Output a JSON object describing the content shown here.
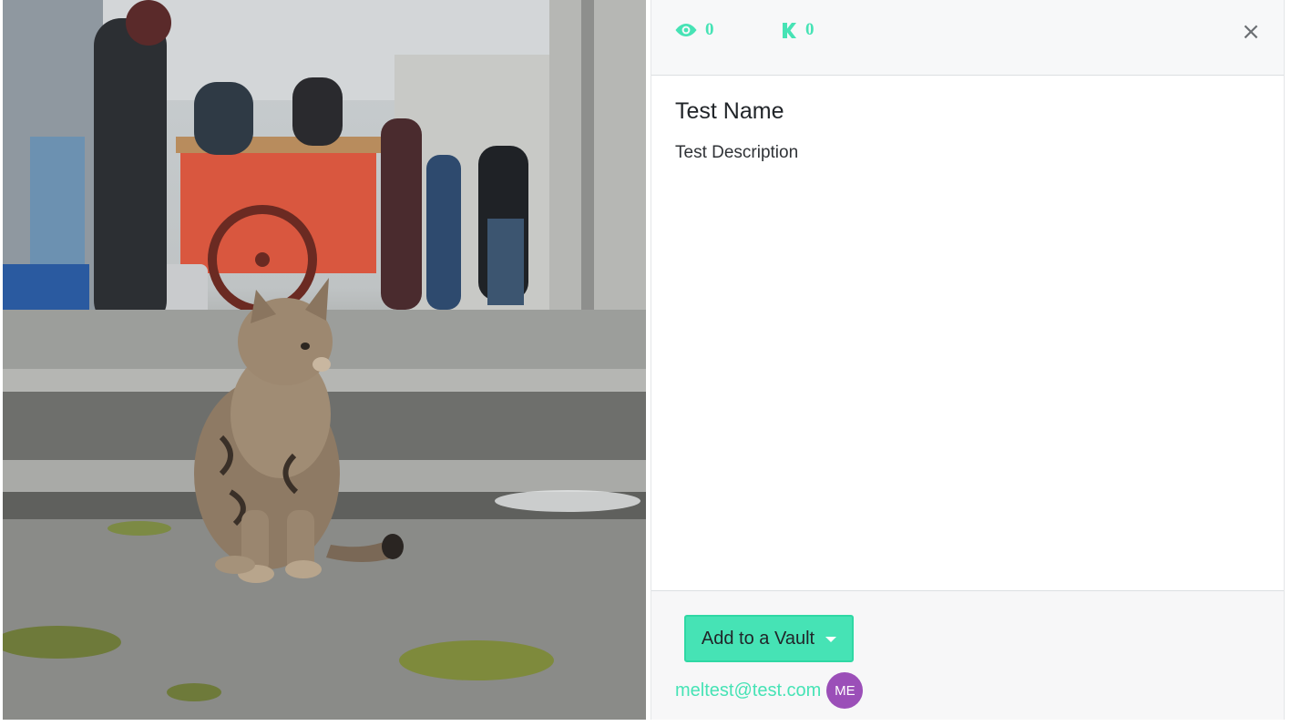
{
  "keep": {
    "title": "Test Name",
    "description": "Test Description",
    "image_alt": "Tabby kitten sitting on a street curb"
  },
  "stats": {
    "views": "0",
    "keeps": "0",
    "views_icon": "eye-icon",
    "keeps_icon": "k-logo-icon"
  },
  "header": {
    "close_icon": "close-icon",
    "close_glyph": "×"
  },
  "footer": {
    "vault_button_label": "Add to a Vault",
    "owner_email": "meltest@test.com",
    "owner_initials": "ME"
  },
  "colors": {
    "accent": "#46e3b5",
    "avatar": "#9b4fb8",
    "header_bg": "#f7f8f9"
  }
}
